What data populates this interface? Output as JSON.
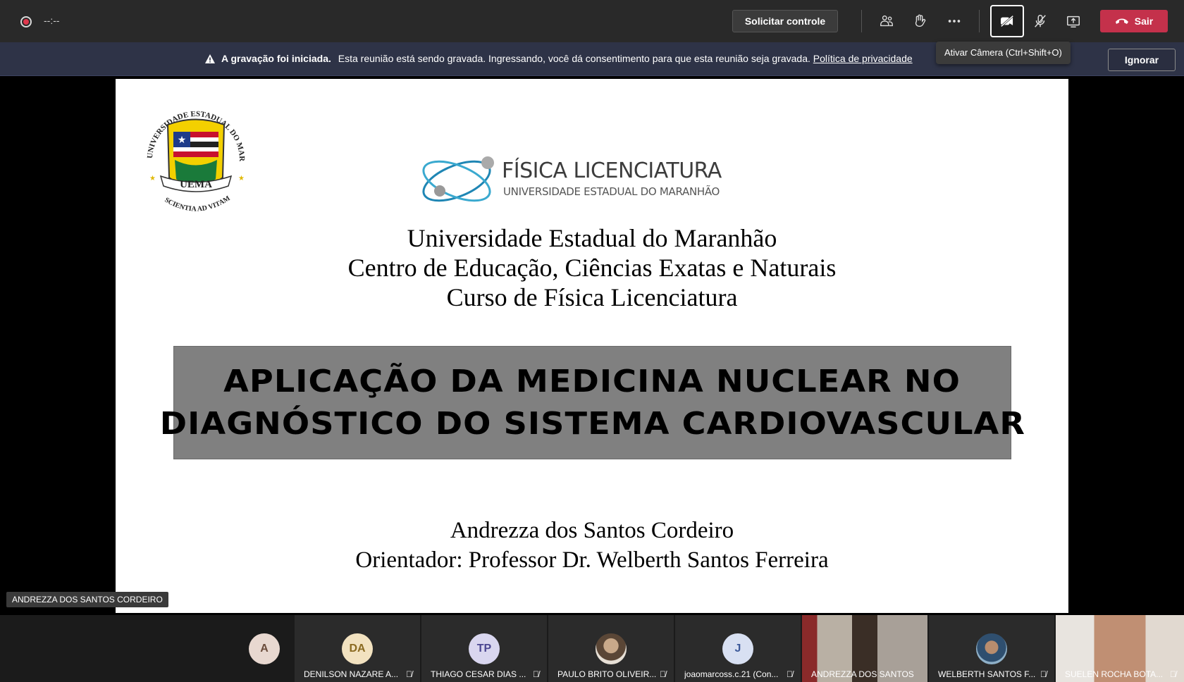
{
  "topbar": {
    "record_time": "--:--",
    "request_control": "Solicitar controle",
    "leave_label": "Sair",
    "camera_tooltip": "Ativar Câmera (Ctrl+Shift+O)"
  },
  "notice": {
    "title": "A gravação foi iniciada.",
    "message": "Esta reunião está sendo gravada. Ingressando, você dá consentimento para que esta reunião seja gravada.",
    "link": "Política de privacidade",
    "dismiss": "Ignorar"
  },
  "slide": {
    "seal": {
      "top_text": "UNIVERSIDADE ESTADUAL DO MARANHÃO",
      "name": "UEMA",
      "motto": "SCIENTIA AD VITAM"
    },
    "logo_title": "FÍSICA LICENCIATURA",
    "logo_subtitle": "UNIVERSIDADE ESTADUAL DO MARANHÃO",
    "university": "Universidade Estadual do Maranhão",
    "center": "Centro de Educação, Ciências Exatas e Naturais",
    "course": "Curso de Física Licenciatura",
    "title_line1": "Aplicação da Medicina Nuclear no",
    "title_line2": "Diagnóstico do Sistema Cardiovascular",
    "author": "Andrezza dos Santos Cordeiro",
    "advisor": "Orientador: Professor Dr. Welberth Santos Ferreira"
  },
  "presenter_name": "ANDREZZA DOS SANTOS CORDEIRO",
  "participants": [
    {
      "initials": "A",
      "name": "",
      "color": "#e8d8d0"
    },
    {
      "initials": "DA",
      "name": "DENILSON NAZARE A...",
      "color": "#f2e2c0"
    },
    {
      "initials": "TP",
      "name": "THIAGO CESAR DIAS ...",
      "color": "#d9d6ef"
    },
    {
      "initials": "",
      "name": "PAULO BRITO OLIVEIR...",
      "color": "#9a8574"
    },
    {
      "initials": "J",
      "name": "joaomarcoss.c.21 (Con...",
      "color": "#d8e0f2"
    },
    {
      "initials": "",
      "name": "ANDREZZA DOS SANTOS ...",
      "color": "#6a5e52"
    },
    {
      "initials": "",
      "name": "WELBERTH SANTOS F...",
      "color": "#7c8a8a"
    },
    {
      "initials": "",
      "name": "SUELEN ROCHA BOTA...",
      "color": "#c9b8a8"
    }
  ],
  "colors": {
    "leave": "#c4314b",
    "notice_bg": "#2e3347",
    "banner": "#808080"
  }
}
